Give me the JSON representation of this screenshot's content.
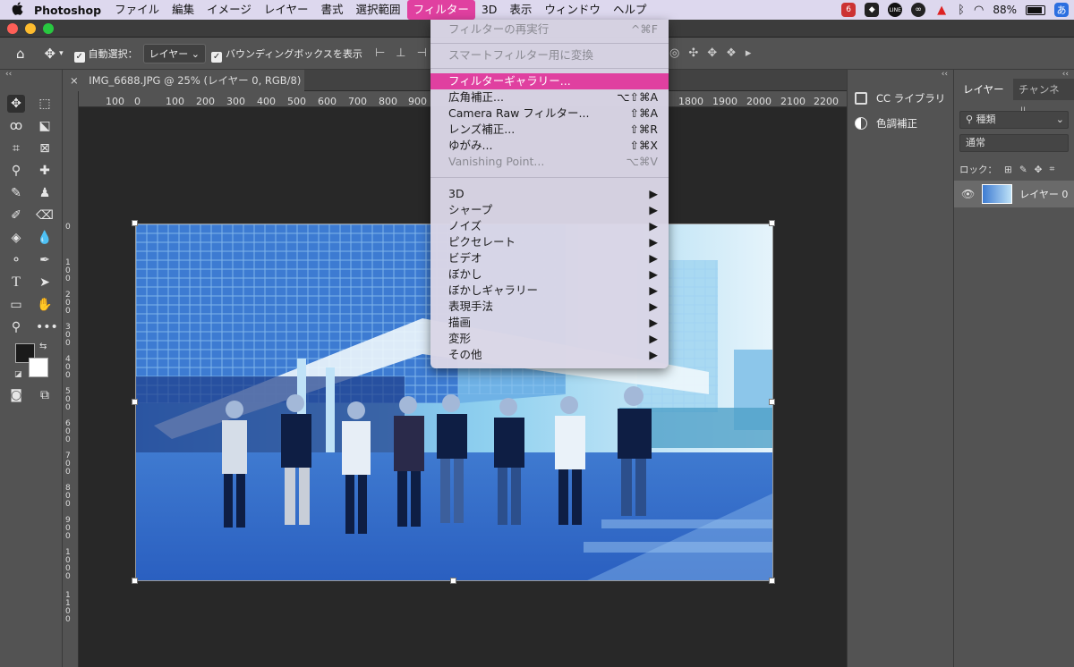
{
  "menubar": {
    "app": "Photoshop",
    "items": [
      "ファイル",
      "編集",
      "イメージ",
      "レイヤー",
      "書式",
      "選択範囲",
      "フィルター",
      "3D",
      "表示",
      "ウィンドウ",
      "ヘルプ"
    ],
    "active_index": 6,
    "battery": "88%",
    "input_method": "あ",
    "notification_badge": "6",
    "line_label": "LINE"
  },
  "optionsbar": {
    "auto_select_label": "自動選択：",
    "auto_select_value": "レイヤー",
    "bounding_box_label": "バウンディングボックスを表示"
  },
  "document": {
    "tab_title": "IMG_6688.JPG @ 25% (レイヤー 0, RGB/8) *",
    "ruler_h_left": [
      "100",
      "0",
      "100",
      "200",
      "300",
      "400",
      "500",
      "600",
      "700",
      "800",
      "900"
    ],
    "ruler_h_right": [
      "1800",
      "1900",
      "2000",
      "2100",
      "2200"
    ],
    "ruler_v_labels": [
      "0",
      "1\n0\n0",
      "2\n0\n0",
      "3\n0\n0",
      "4\n0\n0",
      "5\n0\n0",
      "6\n0\n0",
      "7\n0\n0",
      "8\n0\n0",
      "9\n0\n0",
      "1\n0\n0\n0",
      "1\n1\n0\n0"
    ]
  },
  "filter_menu": {
    "items": [
      {
        "label": "フィルターの再実行",
        "shortcut": "^⌘F",
        "disabled": true
      },
      {
        "label": "スマートフィルター用に変換",
        "shortcut": "",
        "disabled": true
      },
      {
        "label": "フィルターギャラリー...",
        "shortcut": "",
        "highlighted": true
      },
      {
        "label": "広角補正...",
        "shortcut": "⌥⇧⌘A"
      },
      {
        "label": "Camera Raw フィルター...",
        "shortcut": "⇧⌘A"
      },
      {
        "label": "レンズ補正...",
        "shortcut": "⇧⌘R"
      },
      {
        "label": "ゆがみ...",
        "shortcut": "⇧⌘X"
      },
      {
        "label": "Vanishing Point...",
        "shortcut": "⌥⌘V",
        "disabled": true
      },
      {
        "label": "3D",
        "shortcut": "▶"
      },
      {
        "label": "シャープ",
        "shortcut": "▶"
      },
      {
        "label": "ノイズ",
        "shortcut": "▶"
      },
      {
        "label": "ピクセレート",
        "shortcut": "▶"
      },
      {
        "label": "ビデオ",
        "shortcut": "▶"
      },
      {
        "label": "ぼかし",
        "shortcut": "▶"
      },
      {
        "label": "ぼかしギャラリー",
        "shortcut": "▶"
      },
      {
        "label": "表現手法",
        "shortcut": "▶"
      },
      {
        "label": "描画",
        "shortcut": "▶"
      },
      {
        "label": "変形",
        "shortcut": "▶"
      },
      {
        "label": "その他",
        "shortcut": "▶"
      }
    ]
  },
  "side_panel": {
    "cc_libraries": "CC ライブラリ",
    "color_adjust": "色調補正"
  },
  "layers_panel": {
    "tab_layers": "レイヤー",
    "tab_channels": "チャンネル",
    "filter_kind": "種類",
    "blend_mode": "通常",
    "lock_label": "ロック：",
    "layer_name": "レイヤー 0"
  },
  "colors": {
    "accent": "#e040a0",
    "menubar_bg": "#ddd8ee",
    "panel_bg": "#535353"
  }
}
